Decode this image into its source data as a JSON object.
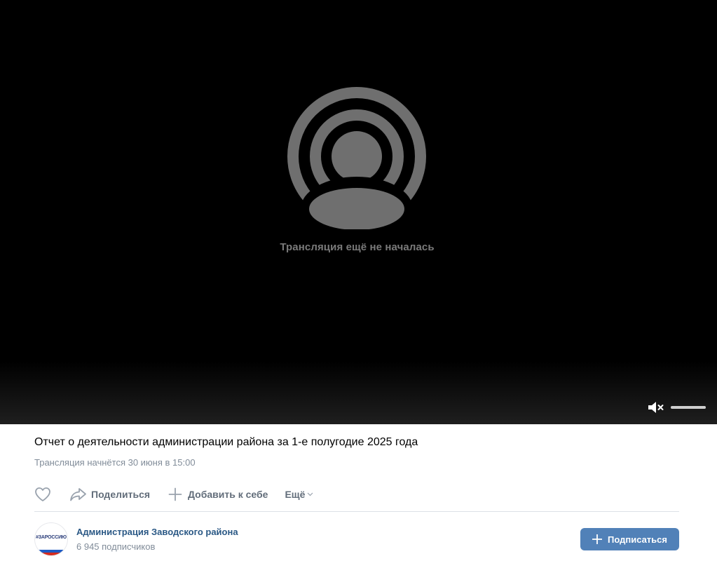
{
  "player": {
    "status_text": "Трансляция ещё не началась",
    "live_icon": "live-broadcast-icon",
    "mute_icon": "volume-muted-icon",
    "volume_level": 1.0
  },
  "video": {
    "title": "Отчет о деятельности администрации района за 1-е полугодие 2025 года",
    "subtitle": "Трансляция начнётся 30 июня в 15:00"
  },
  "actions": {
    "like_icon": "heart-icon",
    "share_icon": "share-arrow-icon",
    "share_label": "Поделиться",
    "add_icon": "plus-icon",
    "add_label": "Добавить к себе",
    "more_label": "Ещё",
    "more_icon": "chevron-down-icon"
  },
  "channel": {
    "avatar_text": "#ЗАРОССИЮ",
    "name": "Администрация Заводского района",
    "subscribers": "6 945 подписчиков",
    "subscribe_label": "Подписаться",
    "subscribe_icon": "plus-icon"
  },
  "colors": {
    "player_bg": "#000000",
    "placeholder_gray": "#6f6f6f",
    "link_blue": "#2a5885",
    "button_blue": "#5181b8",
    "muted_text": "#818c99",
    "action_text": "#626d7a"
  }
}
